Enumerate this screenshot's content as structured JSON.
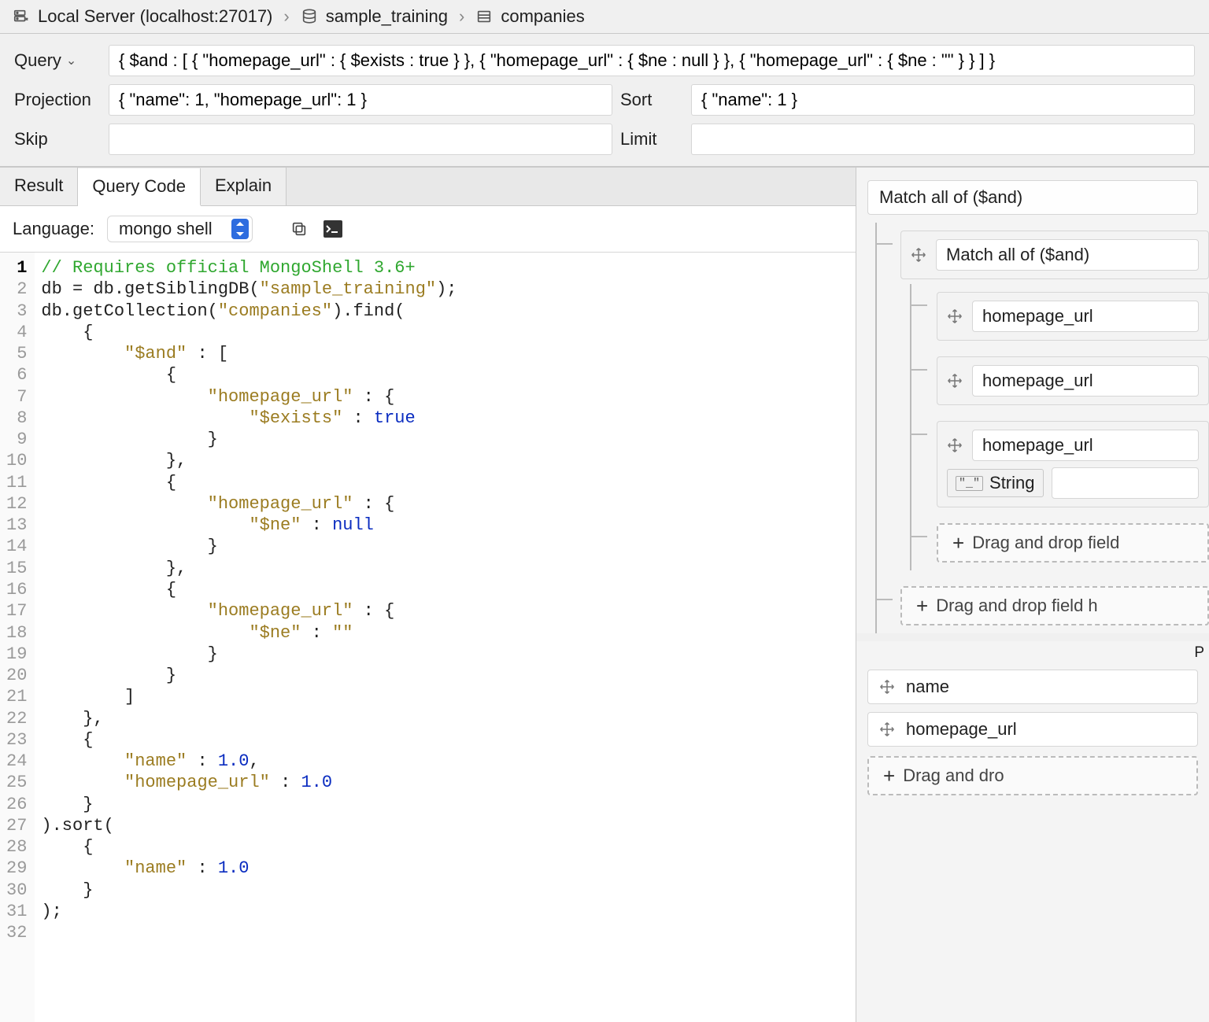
{
  "breadcrumb": {
    "server": "Local Server (localhost:27017)",
    "database": "sample_training",
    "collection": "companies"
  },
  "form": {
    "query_label": "Query",
    "query_value": "{ $and : [ { \"homepage_url\" : { $exists : true } }, { \"homepage_url\" : { $ne : null } }, { \"homepage_url\" : { $ne : \"\" } } ] }",
    "projection_label": "Projection",
    "projection_value": "{ \"name\": 1, \"homepage_url\": 1 }",
    "sort_label": "Sort",
    "sort_value": "{ \"name\": 1 }",
    "skip_label": "Skip",
    "skip_value": "",
    "limit_label": "Limit",
    "limit_value": ""
  },
  "tabs": {
    "result": "Result",
    "query_code": "Query Code",
    "explain": "Explain"
  },
  "language_row": {
    "label": "Language:",
    "selected": "mongo shell"
  },
  "code_lines": [
    {
      "n": 1,
      "html": "<span class=\"c\">// Requires official MongoShell 3.6+</span>"
    },
    {
      "n": 2,
      "html": "db = db.getSiblingDB(<span class=\"s\">\"sample_training\"</span>);"
    },
    {
      "n": 3,
      "html": "db.getCollection(<span class=\"s\">\"companies\"</span>).find("
    },
    {
      "n": 4,
      "html": "    {"
    },
    {
      "n": 5,
      "html": "        <span class=\"s\">\"$and\"</span> : ["
    },
    {
      "n": 6,
      "html": "            {"
    },
    {
      "n": 7,
      "html": "                <span class=\"s\">\"homepage_url\"</span> : {"
    },
    {
      "n": 8,
      "html": "                    <span class=\"s\">\"$exists\"</span> : <span class=\"k\">true</span>"
    },
    {
      "n": 9,
      "html": "                }"
    },
    {
      "n": 10,
      "html": "            },"
    },
    {
      "n": 11,
      "html": "            {"
    },
    {
      "n": 12,
      "html": "                <span class=\"s\">\"homepage_url\"</span> : {"
    },
    {
      "n": 13,
      "html": "                    <span class=\"s\">\"$ne\"</span> : <span class=\"k\">null</span>"
    },
    {
      "n": 14,
      "html": "                }"
    },
    {
      "n": 15,
      "html": "            },"
    },
    {
      "n": 16,
      "html": "            {"
    },
    {
      "n": 17,
      "html": "                <span class=\"s\">\"homepage_url\"</span> : {"
    },
    {
      "n": 18,
      "html": "                    <span class=\"s\">\"$ne\"</span> : <span class=\"s\">\"\"</span>"
    },
    {
      "n": 19,
      "html": "                }"
    },
    {
      "n": 20,
      "html": "            }"
    },
    {
      "n": 21,
      "html": "        ]"
    },
    {
      "n": 22,
      "html": "    },"
    },
    {
      "n": 23,
      "html": "    {"
    },
    {
      "n": 24,
      "html": "        <span class=\"s\">\"name\"</span> : <span class=\"k\">1.0</span>,"
    },
    {
      "n": 25,
      "html": "        <span class=\"s\">\"homepage_url\"</span> : <span class=\"k\">1.0</span>"
    },
    {
      "n": 26,
      "html": "    }"
    },
    {
      "n": 27,
      "html": ").sort("
    },
    {
      "n": 28,
      "html": "    {"
    },
    {
      "n": 29,
      "html": "        <span class=\"s\">\"name\"</span> : <span class=\"k\">1.0</span>"
    },
    {
      "n": 30,
      "html": "    }"
    },
    {
      "n": 31,
      "html": ");"
    },
    {
      "n": 32,
      "html": ""
    }
  ],
  "builder": {
    "top_and": "Match all of ($and)",
    "inner_and": "Match all of ($and)",
    "field_items": [
      "homepage_url",
      "homepage_url",
      "homepage_url"
    ],
    "type_badge": "String",
    "drop_inner": "Drag and drop field ",
    "drop_outer": "Drag and drop field h",
    "proj_header_trunc": "P",
    "proj_name": "name",
    "proj_homepage": "homepage_url",
    "drop_proj": "Drag and dro"
  }
}
